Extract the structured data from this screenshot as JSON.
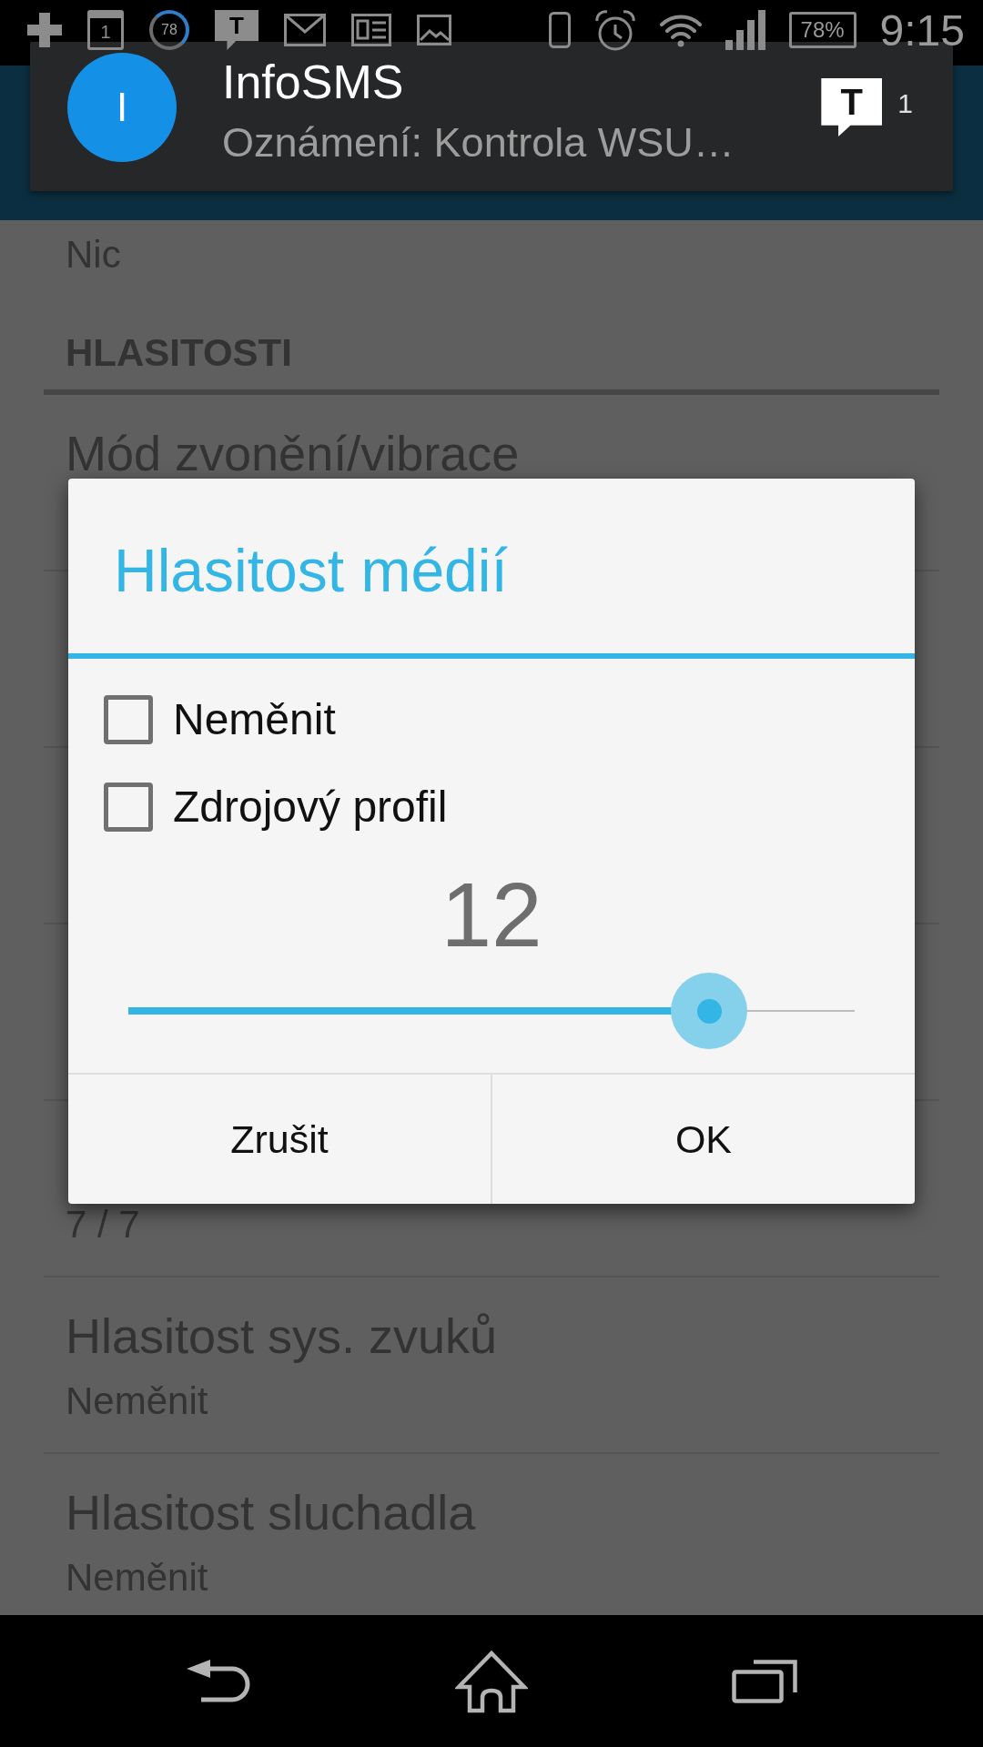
{
  "status_bar": {
    "notification_icons": [
      {
        "kind": "plus"
      },
      {
        "kind": "calendar",
        "text": "1"
      },
      {
        "kind": "gauge",
        "text": "78"
      },
      {
        "kind": "message",
        "text": "T"
      },
      {
        "kind": "mail"
      },
      {
        "kind": "document"
      },
      {
        "kind": "image"
      }
    ],
    "system_icons": [
      {
        "kind": "phone"
      },
      {
        "kind": "alarm"
      },
      {
        "kind": "wifi"
      },
      {
        "kind": "signal"
      },
      {
        "kind": "battery",
        "text": "78%"
      }
    ],
    "time": "9:15"
  },
  "notification": {
    "avatar_letter": "I",
    "title": "InfoSMS",
    "text": "Oznámení: Kontrola WSU…",
    "app_icon_letter": "T",
    "count": "1"
  },
  "settings_list": {
    "top_rows": [
      {
        "kind": "summary_only",
        "summary": "Nic"
      },
      {
        "kind": "category",
        "title": "HLASITOSTI"
      },
      {
        "kind": "preference",
        "title": "Mód zvonění/vibrace"
      }
    ],
    "bottom_rows": [
      {
        "kind": "preference",
        "summary": "7 / 7"
      },
      {
        "kind": "preference",
        "title": "Hlasitost sys. zvuků",
        "summary": "Neměnit"
      },
      {
        "kind": "preference",
        "title": "Hlasitost sluchadla",
        "summary": "Neměnit"
      }
    ]
  },
  "dialog": {
    "title": "Hlasitost médií",
    "options": [
      {
        "label": "Neměnit",
        "checked": false
      },
      {
        "label": "Zdrojový profil",
        "checked": false
      }
    ],
    "value": "12",
    "slider": {
      "level": 0.8
    },
    "buttons": [
      {
        "label": "Zrušit"
      },
      {
        "label": "OK"
      }
    ]
  },
  "nav_bar": {
    "buttons": [
      {
        "kind": "back"
      },
      {
        "kind": "home"
      },
      {
        "kind": "recents"
      }
    ]
  }
}
